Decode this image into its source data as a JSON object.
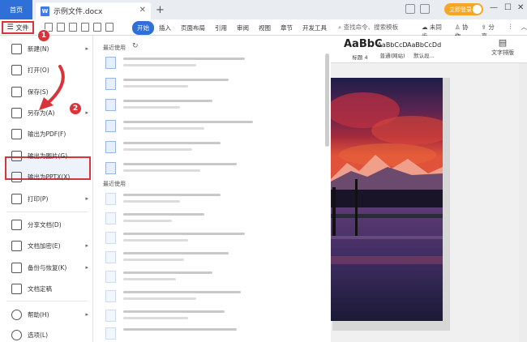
{
  "titlebar": {
    "home_tab": "首页",
    "doc_tab": "示例文件.docx",
    "doc_icon_label": "W",
    "login_label": "立即登录"
  },
  "toolbar": {
    "file_label": "文件",
    "tabs": [
      "开始",
      "插入",
      "页面布局",
      "引用",
      "审阅",
      "视图",
      "章节",
      "开发工具"
    ],
    "search": "查找命令、搜索模板",
    "sync": "未同步",
    "collab": "协作",
    "share": "分享"
  },
  "ribbon": {
    "styles": [
      {
        "sample": "AaBbC",
        "name": "标题 4"
      },
      {
        "sample": "AaBbCcD",
        "name": "普通(网站)"
      },
      {
        "sample": "AaBbCcDd",
        "name": "默认段..."
      }
    ],
    "text_layout": "文字排版"
  },
  "badges": [
    "1",
    "2"
  ],
  "file_menu": {
    "items": [
      {
        "label": "新建(N)",
        "arrow": true
      },
      {
        "label": "打开(O)",
        "arrow": false
      },
      {
        "label": "保存(S)",
        "arrow": false
      },
      {
        "label": "另存为(A)",
        "arrow": true
      },
      {
        "label": "输出为PDF(F)",
        "arrow": false
      },
      {
        "label": "输出为图片(G)",
        "arrow": false
      },
      {
        "label": "输出为PPTX(X)",
        "arrow": false
      },
      {
        "label": "打印(P)",
        "arrow": true
      },
      {
        "label": "分享文档(D)",
        "arrow": false
      },
      {
        "label": "文档加密(E)",
        "arrow": true
      },
      {
        "label": "备份与恢复(K)",
        "arrow": true
      },
      {
        "label": "文档定稿",
        "arrow": false
      },
      {
        "label": "帮助(H)",
        "arrow": true
      },
      {
        "label": "选项(L)",
        "arrow": false
      }
    ]
  },
  "recent": {
    "title1": "最近使用",
    "title2": "最近使用"
  },
  "colors": {
    "accent": "#2f6fd8",
    "highlight": "#d9343a",
    "login": "#f5a623"
  }
}
